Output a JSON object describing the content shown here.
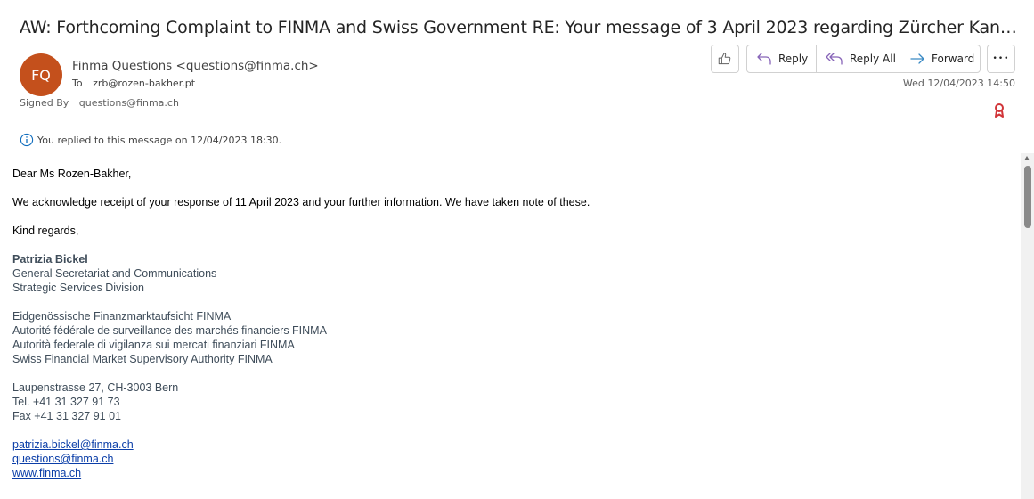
{
  "email": {
    "subject": "AW: Forthcoming Complaint to FINMA and Swiss Government RE: Your message of 3 April 2023 regarding Zürcher Kantonalbank (ZKB)",
    "avatar_initials": "FQ",
    "avatar_color": "#c4501c",
    "sender": "Finma Questions <questions@finma.ch>",
    "to_label": "To",
    "to_value": "zrb@rozen-bakher.pt",
    "signed_label": "Signed By",
    "signed_value": "questions@finma.ch",
    "date": "Wed 12/04/2023 14:50",
    "replied_notice": "You replied to this message on 12/04/2023 18:30."
  },
  "actions": {
    "like_icon": "thumbs-up-icon",
    "reply": "Reply",
    "reply_all": "Reply All",
    "forward": "Forward",
    "more_icon": "more-icon",
    "more_glyph": "•••"
  },
  "body": {
    "greeting": "Dear Ms Rozen-Bakher,",
    "para1": "We acknowledge receipt of your response of 11 April 2023 and your further information. We have taken note of these.",
    "closing": "Kind regards,",
    "sig_name": "Patrizia Bickel",
    "sig_title": "General Secretariat and Communications",
    "sig_division": "Strategic Services Division",
    "org_de": "Eidgenössische Finanzmarktaufsicht FINMA",
    "org_fr": "Autorité fédérale de surveillance des marchés financiers FINMA",
    "org_it": "Autorità federale di vigilanza sui mercati finanziari FINMA",
    "org_en": "Swiss Financial Market Supervisory Authority FINMA",
    "address": "Laupenstrasse 27, CH-3003 Bern",
    "tel": "Tel. +41 31 327 91 73",
    "fax": "Fax +41 31 327 91 01",
    "link_email": "patrizia.bickel@finma.ch",
    "link_questions": "questions@finma.ch",
    "link_web": "www.finma.ch"
  }
}
